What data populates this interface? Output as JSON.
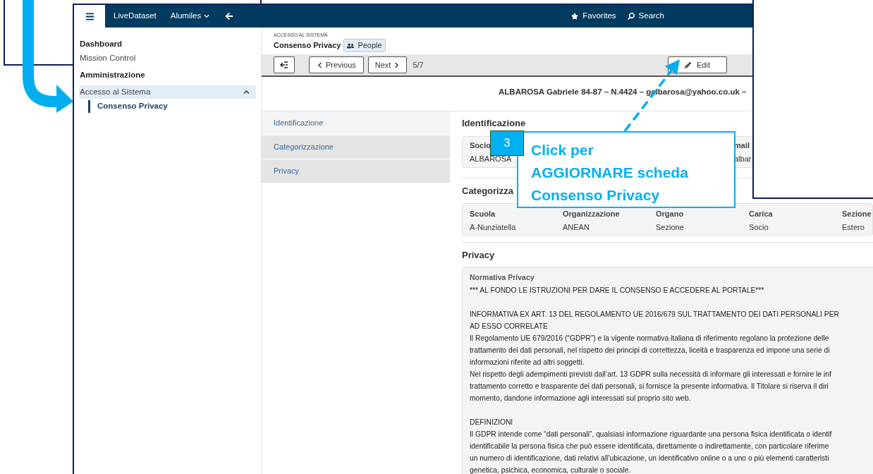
{
  "header": {
    "brand": "LiveDataset",
    "menu": "Alumiles",
    "favorites": "Favorites",
    "search": "Search"
  },
  "sidebar": {
    "items": [
      {
        "kind": "heading",
        "label": "Dashboard"
      },
      {
        "kind": "link",
        "label": "Mission Control"
      },
      {
        "kind": "heading",
        "label": "Amministrazione"
      },
      {
        "kind": "group",
        "label": "Accesso al Sistema",
        "expanded": true,
        "children": [
          {
            "label": "Consenso Privacy",
            "selected": true
          }
        ]
      }
    ]
  },
  "page": {
    "breadcrumb": "ACCESSO AL SISTEMA",
    "title": "Consenso Privacy",
    "tag": "People"
  },
  "toolbar": {
    "previous": "Previous",
    "next": "Next",
    "counter": "5/7",
    "edit": "Edit"
  },
  "record_summary": "ALBAROSA Gabriele 84-87 – N.4424 – galbarosa@yahoo.co.uk –",
  "tabs": [
    {
      "label": "Identificazione",
      "selected": true
    },
    {
      "label": "Categorizzazione",
      "selected": false
    },
    {
      "label": "Privacy",
      "selected": false
    }
  ],
  "sections": [
    {
      "kind": "fields",
      "title": "Identificazione",
      "fields": [
        {
          "label": "Socio",
          "value": "ALBAROSA"
        },
        {
          "label": "mail",
          "value": "albar"
        }
      ]
    },
    {
      "kind": "grid",
      "title": "Categorizza",
      "fields": [
        {
          "label": "Scuola",
          "value": "A-Nunziatella"
        },
        {
          "label": "Organizzazione",
          "value": "ANEAN"
        },
        {
          "label": "Organo",
          "value": "Sezione"
        },
        {
          "label": "Carica",
          "value": "Socio"
        },
        {
          "label": "Sezione",
          "value": "Estero"
        }
      ]
    },
    {
      "kind": "note",
      "title": "Privacy",
      "note_title": "Normativa Privacy",
      "paragraphs": [
        [
          "*** AL FONDO LE ISTRUZIONI PER DARE IL CONSENSO E ACCEDERE AL PORTALE***"
        ],
        [
          "INFORMATIVA EX ART. 13 DEL REGOLAMENTO UE 2016/679 SUL TRATTAMENTO DEI DATI PERSONALI PER",
          "AD ESSO CORRELATE",
          "Il Regolamento UE 679/2016 (“GDPR”) e la vigente normativa italiana di riferimento regolano la protezione delle",
          "trattamento dei dati personali, nel rispetto dei principi di correttezza, liceità e trasparenza ed impone una serie di",
          "informazioni riferite ad altri soggetti.",
          "Nel rispetto degli adempimenti previsti dall’art. 13 GDPR sulla necessità di informare gli interessati e fornire le inf",
          "trattamento corretto e trasparente dei dati personali, si fornisce la presente informativa. Il Titolare si riserva il diri",
          "momento, dandone informazione agli interessati sul proprio sito web."
        ],
        [
          "DEFINIZIONI",
          "Il GDPR intende come “dati personali”, qualsiasi informazione riguardante una persona fisica identificata o identif",
          "identificabile la persona fisica che può essere identificata, direttamente o indirettamente, con particolare riferime",
          "un numero di identificazione, dati relativi all’ubicazione, un identificativo online o a uno o più elementi caratteristi",
          "genetica, psichica, economica, culturale o sociale."
        ]
      ]
    }
  ],
  "callout": {
    "number": "3",
    "lines": [
      "Click per",
      "AGGIORNARE scheda",
      "Consenso Privacy"
    ]
  }
}
